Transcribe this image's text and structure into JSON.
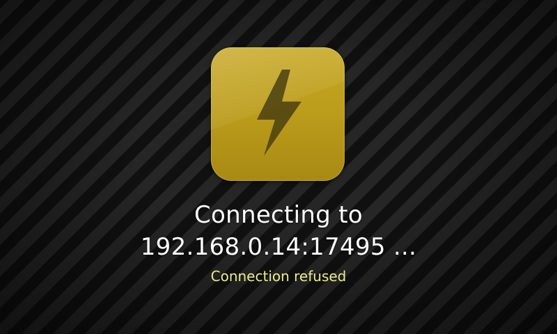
{
  "icon": {
    "name": "lightning-bolt-icon",
    "background_color": "#c2a220",
    "glyph_color": "#4a3f10"
  },
  "status": {
    "connecting_line1": "Connecting to",
    "connecting_line2": "192.168.0.14:17495 ...",
    "error": "Connection refused",
    "error_color": "#ecec8a"
  }
}
